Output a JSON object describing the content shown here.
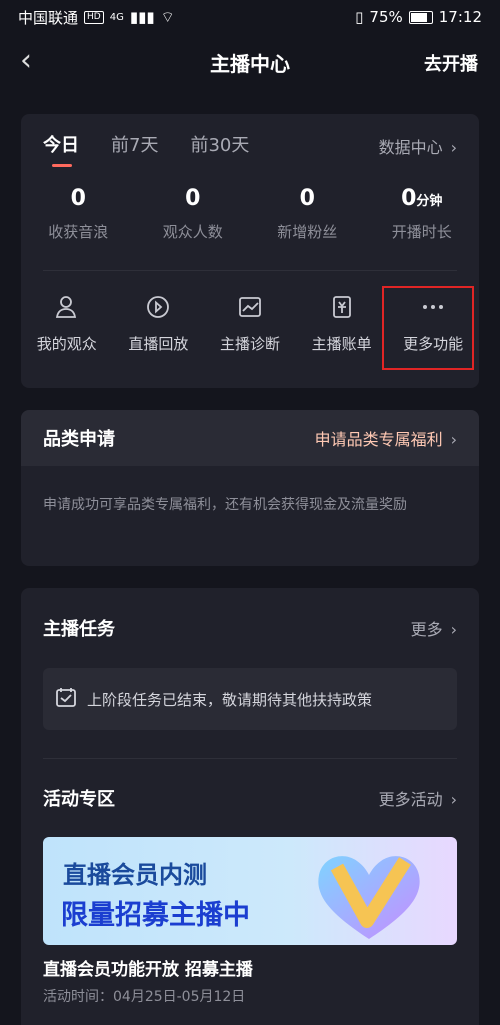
{
  "status_bar": {
    "carrier": "中国联通",
    "hd": "HD",
    "network": "4G",
    "battery": "75%",
    "time": "17:12"
  },
  "header": {
    "title": "主播中心",
    "action": "去开播"
  },
  "stats_card": {
    "tabs": [
      "今日",
      "前7天",
      "前30天"
    ],
    "data_center": "数据中心",
    "stats": [
      {
        "value": "0",
        "unit": "",
        "label": "收获音浪"
      },
      {
        "value": "0",
        "unit": "",
        "label": "观众人数"
      },
      {
        "value": "0",
        "unit": "",
        "label": "新增粉丝"
      },
      {
        "value": "0",
        "unit": "分钟",
        "label": "开播时长"
      }
    ],
    "tools": [
      {
        "label": "我的观众",
        "icon": "user-icon"
      },
      {
        "label": "直播回放",
        "icon": "replay-icon"
      },
      {
        "label": "主播诊断",
        "icon": "chart-icon"
      },
      {
        "label": "主播账单",
        "icon": "bill-icon"
      },
      {
        "label": "更多功能",
        "icon": "more-icon"
      }
    ]
  },
  "category": {
    "title": "品类申请",
    "link": "申请品类专属福利",
    "desc": "申请成功可享品类专属福利，还有机会获得现金及流量奖励"
  },
  "tasks": {
    "title": "主播任务",
    "more": "更多",
    "notice": "上阶段任务已结束，敬请期待其他扶持政策"
  },
  "activity": {
    "title": "活动专区",
    "more": "更多活动",
    "banner_line1": "直播会员内测",
    "banner_line2": "限量招募主播中",
    "item_title": "直播会员功能开放 招募主播",
    "item_time": "活动时间：04月25日-05月12日"
  },
  "colors": {
    "background": "#14151d",
    "card": "#20212b",
    "accent": "#ff6a5e",
    "highlight": "#e02525"
  }
}
